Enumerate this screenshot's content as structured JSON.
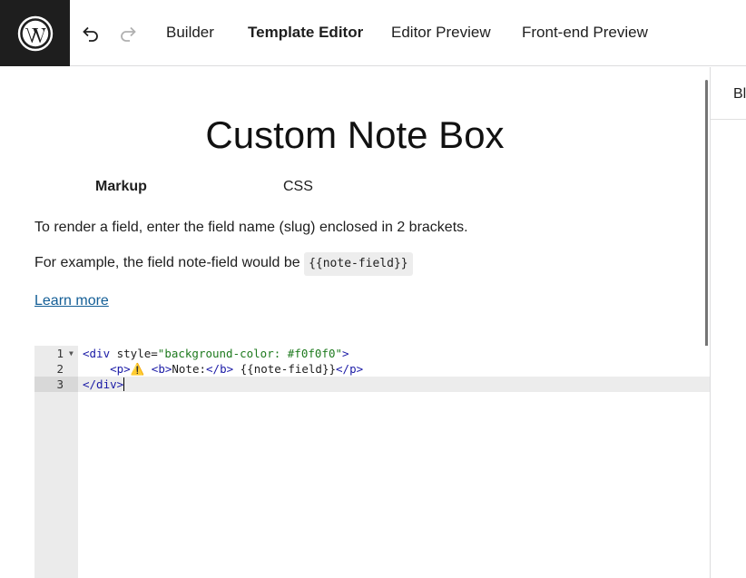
{
  "topbar": {
    "logo": "wordpress-logo",
    "tabs": [
      {
        "label": "Builder",
        "active": false
      },
      {
        "label": "Template Editor",
        "active": true
      },
      {
        "label": "Editor Preview",
        "active": false
      },
      {
        "label": "Front-end Preview",
        "active": false
      }
    ]
  },
  "right_panel": {
    "tab_label": "Bl"
  },
  "main": {
    "title": "Custom Note Box",
    "subtabs": [
      {
        "label": "Markup",
        "active": true
      },
      {
        "label": "CSS",
        "active": false
      }
    ],
    "help_text": "To render a field, enter the field name (slug) enclosed in 2 brackets.",
    "example_prefix": "For example, the field note-field would be ",
    "example_code": "{{note-field}}",
    "learn_more": "Learn more"
  },
  "editor": {
    "lines": [
      {
        "num": "1",
        "open_tag": "<div",
        "attr": " style=",
        "str": "\"background-color: #f0f0f0\"",
        "close": ">"
      },
      {
        "num": "2",
        "indent": "    ",
        "p_open": "<p>",
        "emoji": "⚠️",
        "b_open": " <b>",
        "b_text": "Note:",
        "b_close": "</b>",
        "field": " {{note-field}}",
        "p_close": "</p>"
      },
      {
        "num": "3",
        "close_tag": "</div>"
      }
    ]
  },
  "colors": {
    "accent": "#135e96",
    "logo_bg": "#1e1e1e"
  }
}
